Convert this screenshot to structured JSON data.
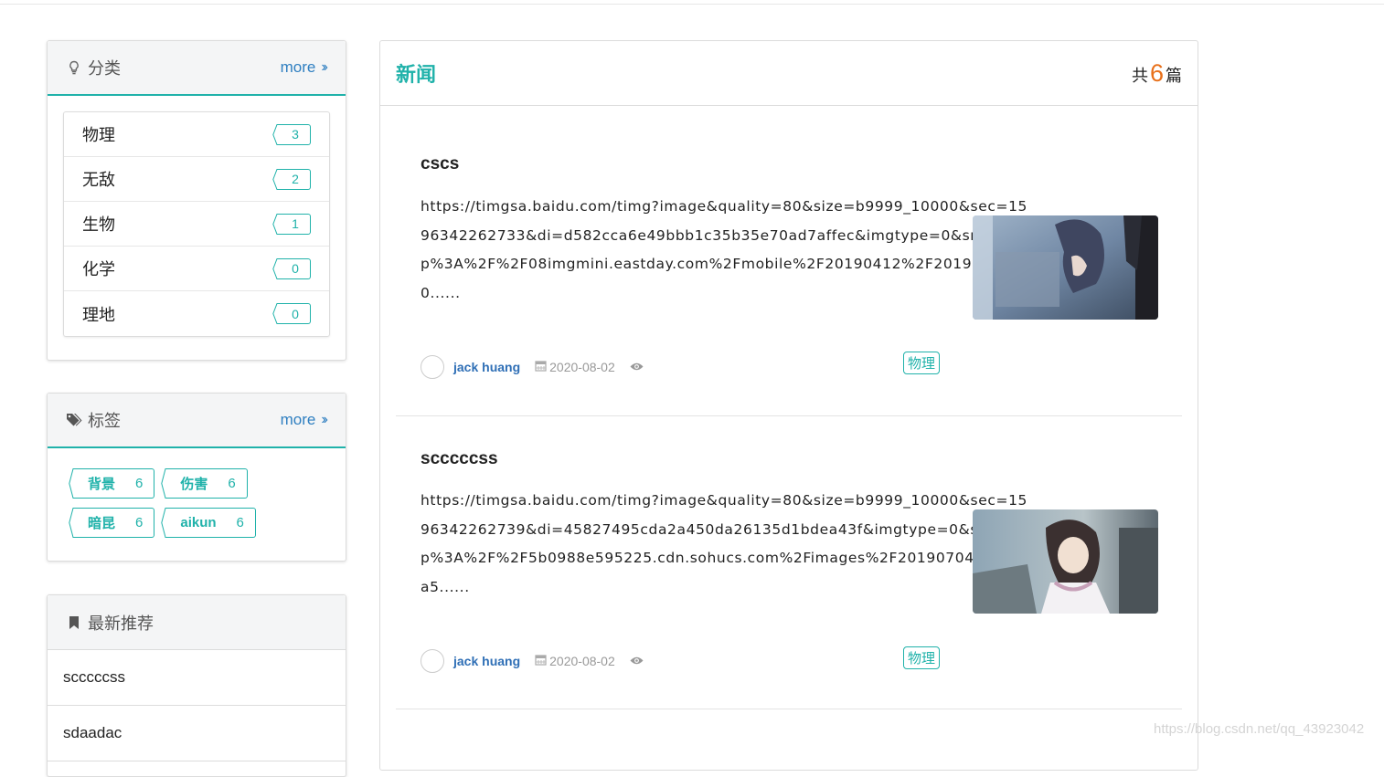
{
  "sidebar": {
    "categories": {
      "title": "分类",
      "more": "more",
      "items": [
        {
          "name": "物理",
          "count": "3"
        },
        {
          "name": "无敌",
          "count": "2"
        },
        {
          "name": "生物",
          "count": "1"
        },
        {
          "name": "化学",
          "count": "0"
        },
        {
          "name": "理地",
          "count": "0"
        }
      ]
    },
    "tags": {
      "title": "标签",
      "more": "more",
      "items": [
        {
          "name": "背景",
          "count": "6"
        },
        {
          "name": "伤害",
          "count": "6"
        },
        {
          "name": "暗昆",
          "count": "6"
        },
        {
          "name": "aikun",
          "count": "6"
        }
      ]
    },
    "recommend": {
      "title": "最新推荐",
      "items": [
        "scccccss",
        "sdaadac"
      ]
    }
  },
  "main": {
    "title": "新闻",
    "total_prefix": "共",
    "total_count": "6",
    "total_suffix": "篇",
    "posts": [
      {
        "title": "cscs",
        "body": "https://timgsa.baidu.com/timg?image&quality=80&size=b9999_10000&sec=1596342262733&di=d582cca6e49bbb1c35b35e70ad7affec&imgtype=0&src=http%3A%2F%2F08imgmini.eastday.com%2Fmobile%2F20190412%2F20190412010......",
        "author": "jack huang",
        "date": "2020-08-02",
        "category": "物理"
      },
      {
        "title": "scccccss",
        "body": "https://timgsa.baidu.com/timg?image&quality=80&size=b9999_10000&sec=1596342262739&di=45827495cda2a450da26135d1bdea43f&imgtype=0&src=http%3A%2F%2F5b0988e595225.cdn.sohucs.com%2Fimages%2F20190704%2F90a5......",
        "author": "jack huang",
        "date": "2020-08-02",
        "category": "物理"
      }
    ]
  },
  "watermark": "https://blog.csdn.net/qq_43923042",
  "colors": {
    "accent": "#20b2aa",
    "link": "#2f7fc1",
    "count": "#e8701a"
  }
}
